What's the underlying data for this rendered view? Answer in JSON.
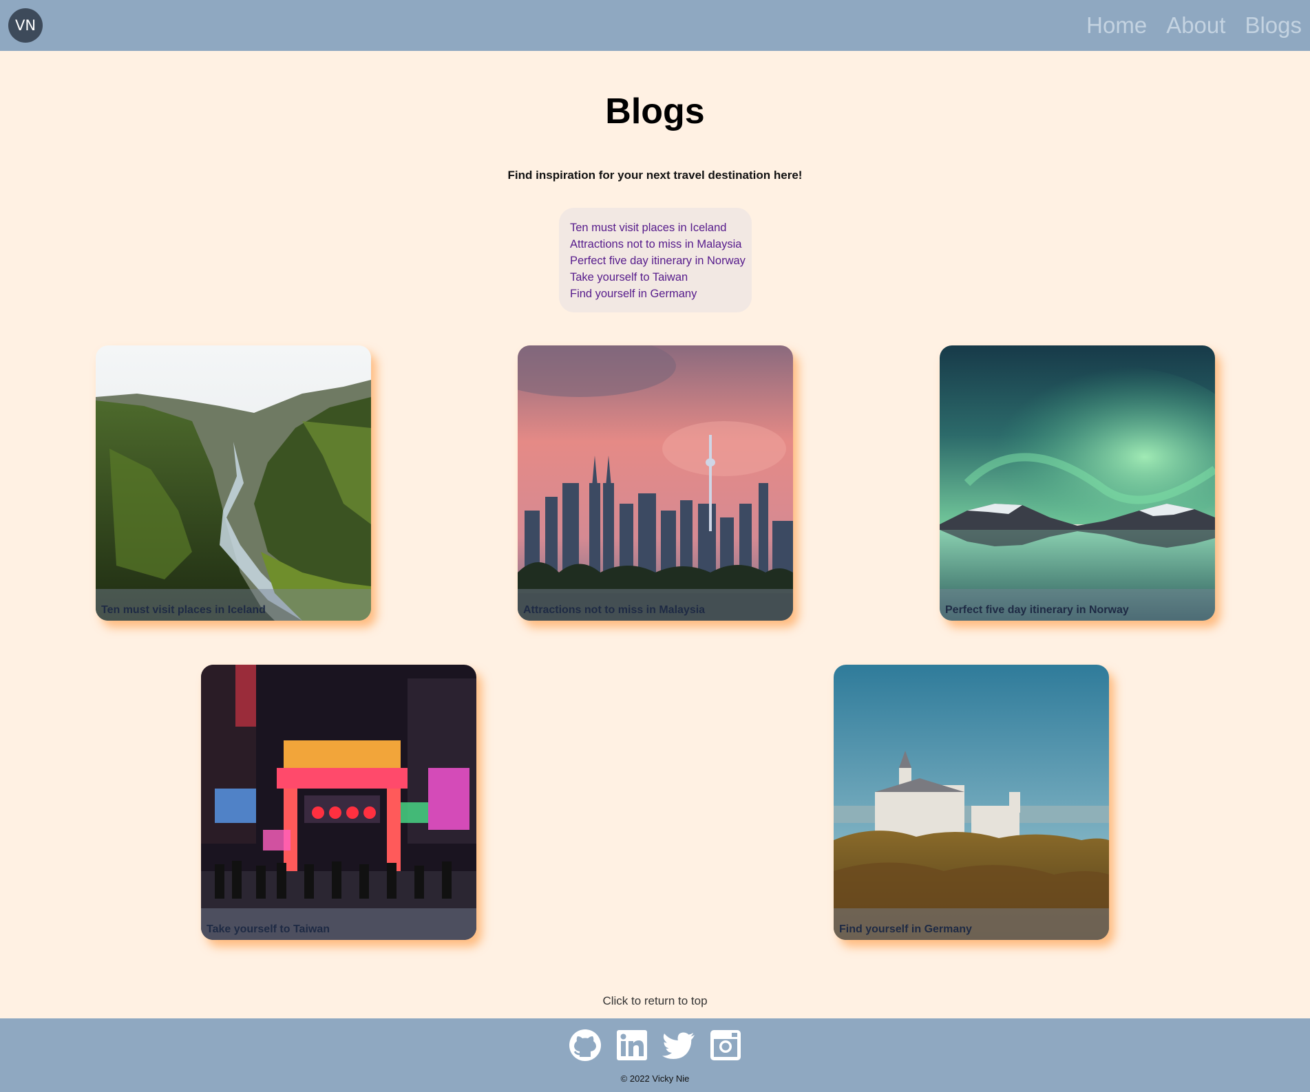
{
  "header": {
    "logo_text": "VN",
    "nav": [
      {
        "label": "Home"
      },
      {
        "label": "About"
      },
      {
        "label": "Blogs"
      }
    ]
  },
  "main": {
    "title": "Blogs",
    "subtitle": "Find inspiration for your next travel destination here!",
    "toc": [
      "Ten must visit places in Iceland",
      "Attractions not to miss in Malaysia",
      "Perfect five day itinerary in Norway",
      "Take yourself to Taiwan",
      "Find yourself in Germany"
    ],
    "cards": [
      {
        "caption": "Ten must visit places in Iceland"
      },
      {
        "caption": "Attractions not to miss in Malaysia"
      },
      {
        "caption": "Perfect five day itinerary in Norway"
      },
      {
        "caption": "Take yourself to Taiwan"
      },
      {
        "caption": "Find yourself in Germany"
      }
    ]
  },
  "footer": {
    "return_top": "Click to return to top",
    "social_icons": [
      "github-icon",
      "linkedin-icon",
      "twitter-icon",
      "instagram-icon"
    ],
    "copyright": "© 2022 Vicky Nie"
  },
  "colors": {
    "background": "#fff1e3",
    "header_footer": "#8fa8c1",
    "nav_text": "#c4d3e1",
    "link": "#551a8b",
    "card_shadow": "#ffaa5f"
  }
}
